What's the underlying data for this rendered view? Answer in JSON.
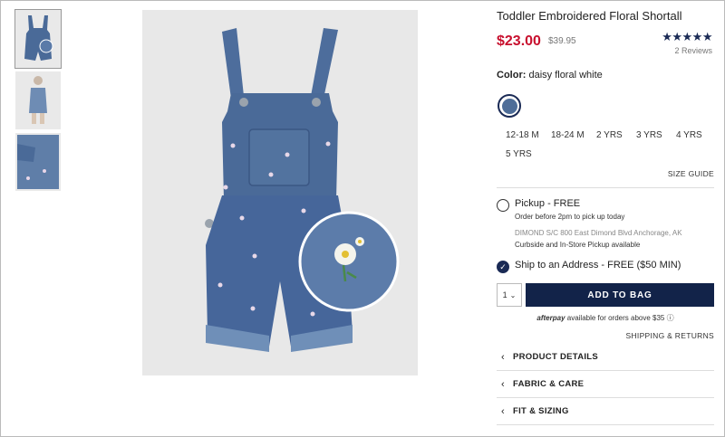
{
  "product": {
    "title": "Toddler Embroidered Floral Shortall",
    "price": "$23.00",
    "original_price": "$39.95",
    "stars": "★★★★★",
    "reviews": "2 Reviews"
  },
  "color": {
    "label": "Color:",
    "value": "daisy floral white",
    "swatch_hex": "#4e6d98"
  },
  "sizes": [
    "12-18 M",
    "18-24 M",
    "2 YRS",
    "3 YRS",
    "4 YRS",
    "5 YRS"
  ],
  "size_guide": "SIZE GUIDE",
  "fulfillment": {
    "pickup_title": "Pickup - FREE",
    "pickup_sub": "Order before 2pm to pick up today",
    "pickup_address": "DIMOND S/C 800 East Dimond Blvd Anchorage, AK",
    "pickup_note": "Curbside and In-Store Pickup available",
    "ship_label": "Ship to an Address",
    "ship_price": " - FREE ($50 MIN)"
  },
  "cart": {
    "qty": "1",
    "add_to_bag": "ADD TO BAG"
  },
  "afterpay": {
    "brand": "afterpay",
    "text": " available for orders above $35 ⓘ"
  },
  "shipping_returns": "SHIPPING & RETURNS",
  "accordion": [
    "PRODUCT DETAILS",
    "FABRIC & CARE",
    "FIT & SIZING"
  ],
  "colors": {
    "price_red": "#c8102e",
    "navy": "#122349",
    "denim": "#4a6a98"
  }
}
